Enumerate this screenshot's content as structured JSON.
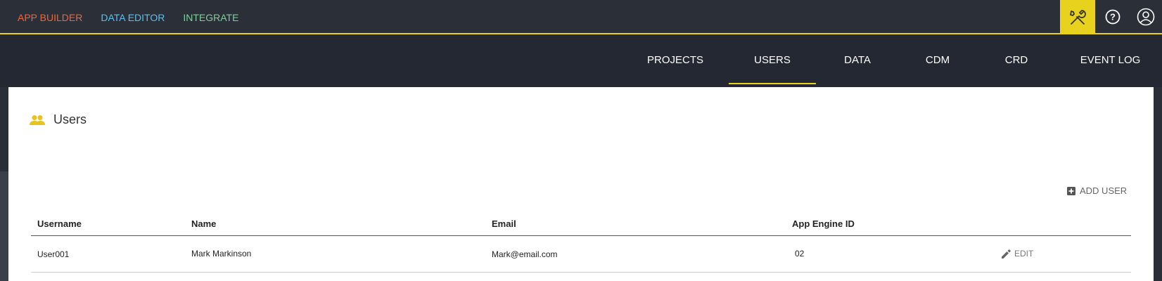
{
  "topbar": {
    "links": [
      {
        "label": "APP BUILDER",
        "color": "#f0643c"
      },
      {
        "label": "DATA EDITOR",
        "color": "#5bc0eb"
      },
      {
        "label": "INTEGRATE",
        "color": "#7fcf9a"
      }
    ],
    "icons": [
      "tools-icon",
      "help-icon",
      "user-account-icon"
    ],
    "accent": "#e8d21d"
  },
  "nav": {
    "items": [
      "PROJECTS",
      "USERS",
      "DATA",
      "CDM",
      "CRD",
      "EVENT LOG"
    ],
    "active": "USERS"
  },
  "page": {
    "title": "Users",
    "title_icon": "users-icon",
    "add_user_label": "ADD USER"
  },
  "table": {
    "headers": [
      "Username",
      "Name",
      "Email",
      "App Engine ID"
    ],
    "rows": [
      {
        "username": "User001",
        "name": "Mark Markinson",
        "email": "Mark@email.com",
        "app_engine_id": "02",
        "action": "EDIT"
      }
    ]
  }
}
